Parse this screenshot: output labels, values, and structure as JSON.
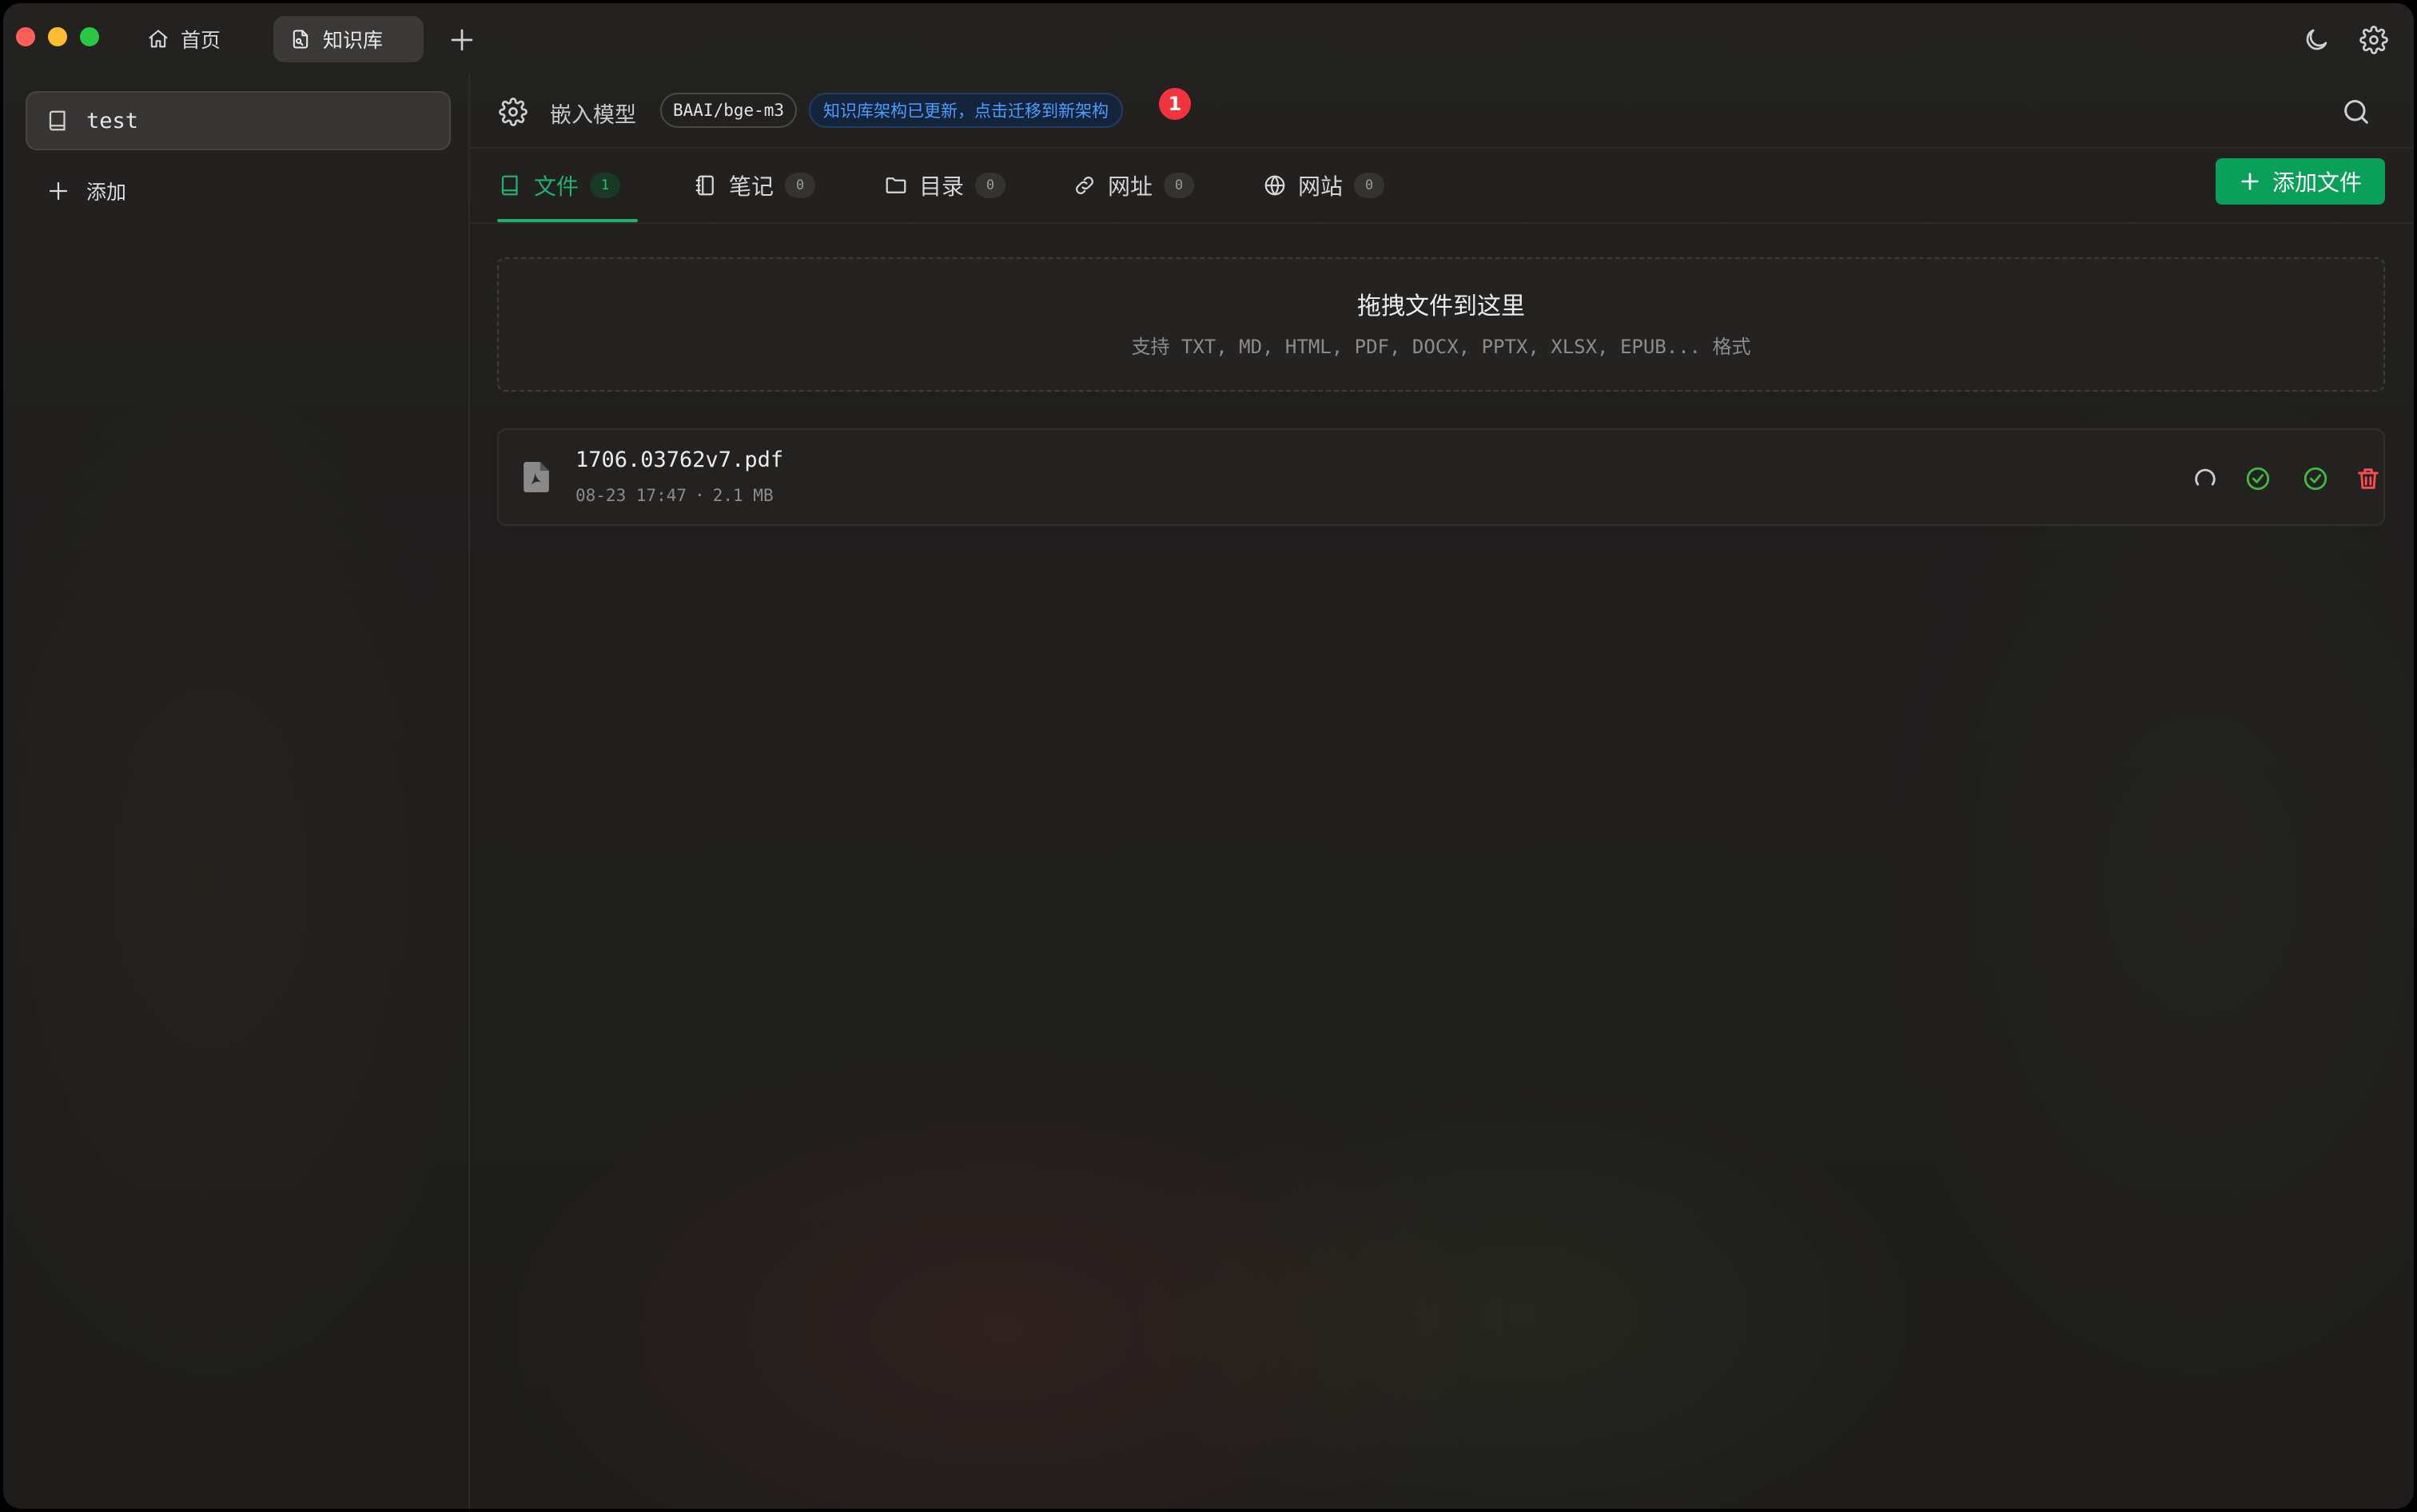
{
  "titlebar": {
    "tabs": [
      {
        "label": "首页",
        "icon": "home-icon"
      },
      {
        "label": "知识库",
        "icon": "knowledge-file-icon",
        "active": true
      }
    ],
    "new_tab_icon": "plus-icon",
    "right_icons": [
      "moon-icon",
      "gear-icon"
    ]
  },
  "sidebar": {
    "items": [
      {
        "label": "test",
        "icon": "book-icon",
        "selected": true
      }
    ],
    "add_label": "添加"
  },
  "model_bar": {
    "label": "嵌入模型",
    "model": "BAAI/bge-m3",
    "notice": "知识库架构已更新，点击迁移到新架构",
    "badge": "1"
  },
  "tabs": [
    {
      "label": "文件",
      "count": "1",
      "icon": "book-icon",
      "active": true
    },
    {
      "label": "笔记",
      "count": "0",
      "icon": "notebook-icon"
    },
    {
      "label": "目录",
      "count": "0",
      "icon": "folder-icon"
    },
    {
      "label": "网址",
      "count": "0",
      "icon": "link-icon"
    },
    {
      "label": "网站",
      "count": "0",
      "icon": "globe-icon"
    }
  ],
  "add_file_button": "添加文件",
  "dropzone": {
    "title": "拖拽文件到这里",
    "subtitle": "支持 TXT, MD, HTML, PDF, DOCX, PPTX, XLSX, EPUB... 格式"
  },
  "files": [
    {
      "name": "1706.03762v7.pdf",
      "date": "08-23 17:47",
      "separator": "·",
      "size": "2.1 MB"
    }
  ],
  "colors": {
    "accent_green": "#1fb26b",
    "button_green": "#0aa05a",
    "notice_blue": "#4a9dff",
    "badge_red": "#f5333f",
    "success_green": "#3fba3f",
    "delete_red": "#ff4d4f"
  }
}
